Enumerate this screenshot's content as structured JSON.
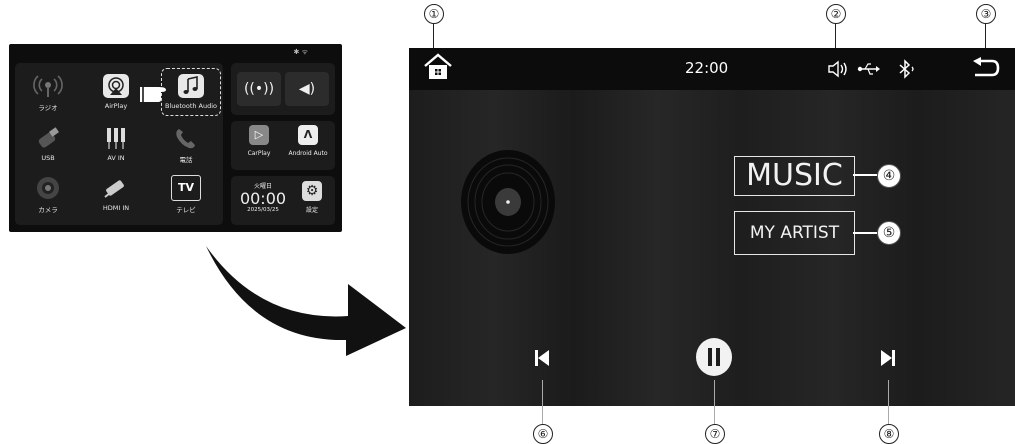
{
  "mini_screen": {
    "status_icons": "✱ ᯤ",
    "apps": [
      {
        "label": "ラジオ",
        "icon": "radio-icon"
      },
      {
        "label": "AirPlay",
        "icon": "airplay-icon"
      },
      {
        "label": "Bluetooth Audio",
        "icon": "music-note-icon"
      },
      {
        "label": "USB",
        "icon": "usb-icon"
      },
      {
        "label": "AV IN",
        "icon": "av-in-icon"
      },
      {
        "label": "電話",
        "icon": "phone-icon"
      },
      {
        "label": "カメラ",
        "icon": "camera-icon"
      },
      {
        "label": "HDMI IN",
        "icon": "hdmi-icon"
      },
      {
        "label": "テレビ",
        "icon": "tv-icon"
      }
    ],
    "tv_text": "TV",
    "carplay_label": "CarPlay",
    "android_auto_label": "Android Auto",
    "clock": {
      "weekday": "火曜日",
      "time": "00:00",
      "date": "2025/03/25"
    },
    "settings_label": "設定"
  },
  "music_screen": {
    "status_bar": {
      "time": "22:00"
    },
    "music_label": "MUSIC",
    "artist_label": "MY ARTIST"
  },
  "callouts": [
    "①",
    "②",
    "③",
    "④",
    "⑤",
    "⑥",
    "⑦",
    "⑧"
  ],
  "colors": {
    "screen_bg": "#1f1f1f",
    "status_bar": "#0c0c0c",
    "arrow": "#111111"
  }
}
